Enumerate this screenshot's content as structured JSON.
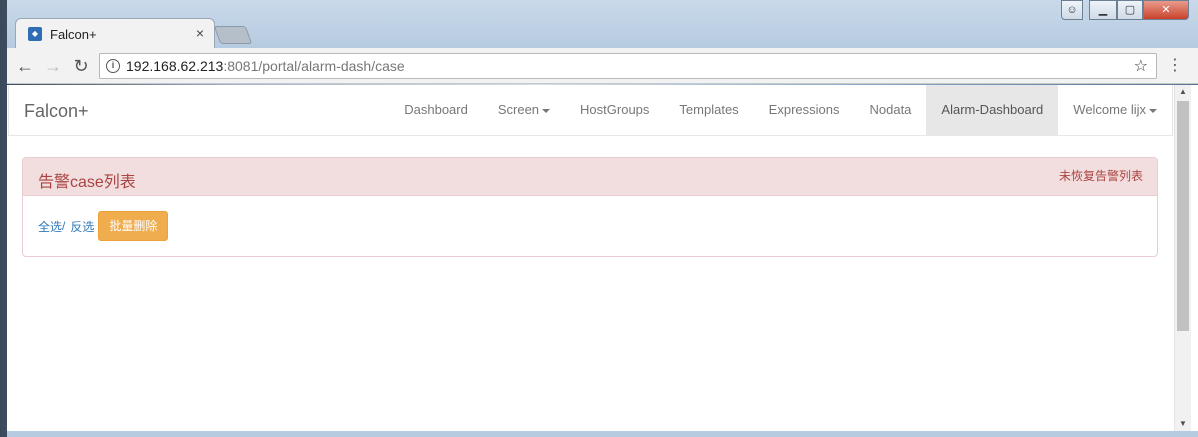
{
  "browser": {
    "tab_title": "Falcon+",
    "tab_close": "×",
    "url_host": "192.168.62.213",
    "url_rest": ":8081/portal/alarm-dash/case"
  },
  "navbar": {
    "brand": "Falcon+",
    "items": [
      {
        "label": "Dashboard"
      },
      {
        "label": "Screen"
      },
      {
        "label": "HostGroups"
      },
      {
        "label": "Templates"
      },
      {
        "label": "Expressions"
      },
      {
        "label": "Nodata"
      },
      {
        "label": "Alarm-Dashboard"
      },
      {
        "label": "Welcome lijx"
      }
    ]
  },
  "panel": {
    "title": "告警case列表",
    "unrecovered_link": "未恢复告警列表",
    "select_all": "全选",
    "separator": "/",
    "invert_select": "反选",
    "batch_delete": "批量删除"
  },
  "colors": {
    "panel_heading_bg": "#f2dede",
    "panel_text": "#a94442",
    "link": "#337ab7",
    "warning_button": "#f0ad4e"
  }
}
